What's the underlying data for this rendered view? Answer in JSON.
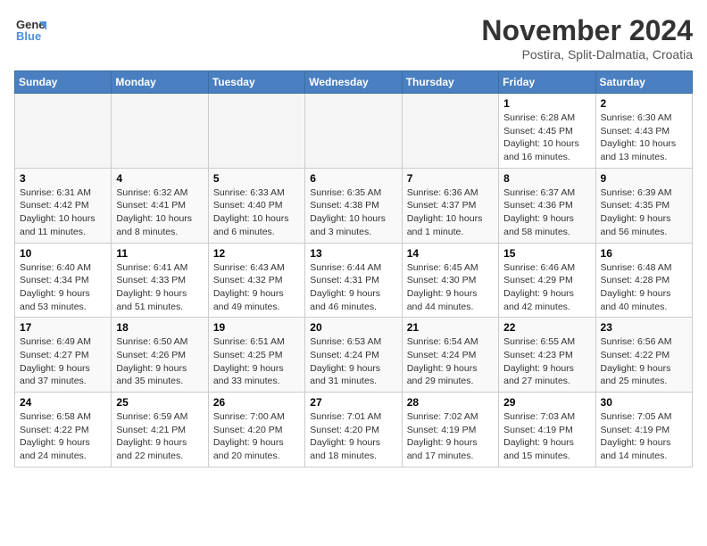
{
  "header": {
    "logo_line1": "General",
    "logo_line2": "Blue",
    "title": "November 2024",
    "subtitle": "Postira, Split-Dalmatia, Croatia"
  },
  "columns": [
    "Sunday",
    "Monday",
    "Tuesday",
    "Wednesday",
    "Thursday",
    "Friday",
    "Saturday"
  ],
  "weeks": [
    [
      {
        "day": "",
        "info": ""
      },
      {
        "day": "",
        "info": ""
      },
      {
        "day": "",
        "info": ""
      },
      {
        "day": "",
        "info": ""
      },
      {
        "day": "",
        "info": ""
      },
      {
        "day": "1",
        "info": "Sunrise: 6:28 AM\nSunset: 4:45 PM\nDaylight: 10 hours and 16 minutes."
      },
      {
        "day": "2",
        "info": "Sunrise: 6:30 AM\nSunset: 4:43 PM\nDaylight: 10 hours and 13 minutes."
      }
    ],
    [
      {
        "day": "3",
        "info": "Sunrise: 6:31 AM\nSunset: 4:42 PM\nDaylight: 10 hours and 11 minutes."
      },
      {
        "day": "4",
        "info": "Sunrise: 6:32 AM\nSunset: 4:41 PM\nDaylight: 10 hours and 8 minutes."
      },
      {
        "day": "5",
        "info": "Sunrise: 6:33 AM\nSunset: 4:40 PM\nDaylight: 10 hours and 6 minutes."
      },
      {
        "day": "6",
        "info": "Sunrise: 6:35 AM\nSunset: 4:38 PM\nDaylight: 10 hours and 3 minutes."
      },
      {
        "day": "7",
        "info": "Sunrise: 6:36 AM\nSunset: 4:37 PM\nDaylight: 10 hours and 1 minute."
      },
      {
        "day": "8",
        "info": "Sunrise: 6:37 AM\nSunset: 4:36 PM\nDaylight: 9 hours and 58 minutes."
      },
      {
        "day": "9",
        "info": "Sunrise: 6:39 AM\nSunset: 4:35 PM\nDaylight: 9 hours and 56 minutes."
      }
    ],
    [
      {
        "day": "10",
        "info": "Sunrise: 6:40 AM\nSunset: 4:34 PM\nDaylight: 9 hours and 53 minutes."
      },
      {
        "day": "11",
        "info": "Sunrise: 6:41 AM\nSunset: 4:33 PM\nDaylight: 9 hours and 51 minutes."
      },
      {
        "day": "12",
        "info": "Sunrise: 6:43 AM\nSunset: 4:32 PM\nDaylight: 9 hours and 49 minutes."
      },
      {
        "day": "13",
        "info": "Sunrise: 6:44 AM\nSunset: 4:31 PM\nDaylight: 9 hours and 46 minutes."
      },
      {
        "day": "14",
        "info": "Sunrise: 6:45 AM\nSunset: 4:30 PM\nDaylight: 9 hours and 44 minutes."
      },
      {
        "day": "15",
        "info": "Sunrise: 6:46 AM\nSunset: 4:29 PM\nDaylight: 9 hours and 42 minutes."
      },
      {
        "day": "16",
        "info": "Sunrise: 6:48 AM\nSunset: 4:28 PM\nDaylight: 9 hours and 40 minutes."
      }
    ],
    [
      {
        "day": "17",
        "info": "Sunrise: 6:49 AM\nSunset: 4:27 PM\nDaylight: 9 hours and 37 minutes."
      },
      {
        "day": "18",
        "info": "Sunrise: 6:50 AM\nSunset: 4:26 PM\nDaylight: 9 hours and 35 minutes."
      },
      {
        "day": "19",
        "info": "Sunrise: 6:51 AM\nSunset: 4:25 PM\nDaylight: 9 hours and 33 minutes."
      },
      {
        "day": "20",
        "info": "Sunrise: 6:53 AM\nSunset: 4:24 PM\nDaylight: 9 hours and 31 minutes."
      },
      {
        "day": "21",
        "info": "Sunrise: 6:54 AM\nSunset: 4:24 PM\nDaylight: 9 hours and 29 minutes."
      },
      {
        "day": "22",
        "info": "Sunrise: 6:55 AM\nSunset: 4:23 PM\nDaylight: 9 hours and 27 minutes."
      },
      {
        "day": "23",
        "info": "Sunrise: 6:56 AM\nSunset: 4:22 PM\nDaylight: 9 hours and 25 minutes."
      }
    ],
    [
      {
        "day": "24",
        "info": "Sunrise: 6:58 AM\nSunset: 4:22 PM\nDaylight: 9 hours and 24 minutes."
      },
      {
        "day": "25",
        "info": "Sunrise: 6:59 AM\nSunset: 4:21 PM\nDaylight: 9 hours and 22 minutes."
      },
      {
        "day": "26",
        "info": "Sunrise: 7:00 AM\nSunset: 4:20 PM\nDaylight: 9 hours and 20 minutes."
      },
      {
        "day": "27",
        "info": "Sunrise: 7:01 AM\nSunset: 4:20 PM\nDaylight: 9 hours and 18 minutes."
      },
      {
        "day": "28",
        "info": "Sunrise: 7:02 AM\nSunset: 4:19 PM\nDaylight: 9 hours and 17 minutes."
      },
      {
        "day": "29",
        "info": "Sunrise: 7:03 AM\nSunset: 4:19 PM\nDaylight: 9 hours and 15 minutes."
      },
      {
        "day": "30",
        "info": "Sunrise: 7:05 AM\nSunset: 4:19 PM\nDaylight: 9 hours and 14 minutes."
      }
    ]
  ]
}
